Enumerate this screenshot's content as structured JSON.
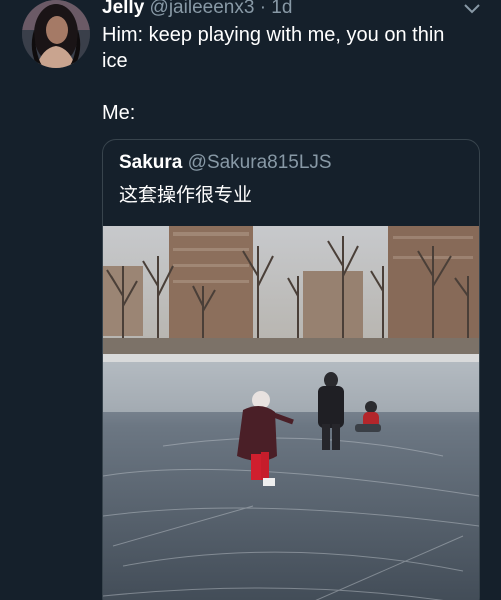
{
  "tweet": {
    "author_name": "Jelly",
    "author_handle": "@jaileeenx3",
    "separator": "·",
    "time": "1d",
    "text_line1": "Him: keep playing with me, you on thin",
    "text_line2": "ice",
    "text_line3": "Me:",
    "menu_icon": "chevron-down-icon",
    "avatar_icon": "profile-photo"
  },
  "quoted_tweet": {
    "author_name": "Sakura",
    "author_handle": "@Sakura815LJS",
    "text": "这套操作很专业",
    "media": "video-thumbnail-ice-skating"
  },
  "colors": {
    "background": "#15202b",
    "secondary_text": "#8899a6",
    "border": "#38444d"
  }
}
